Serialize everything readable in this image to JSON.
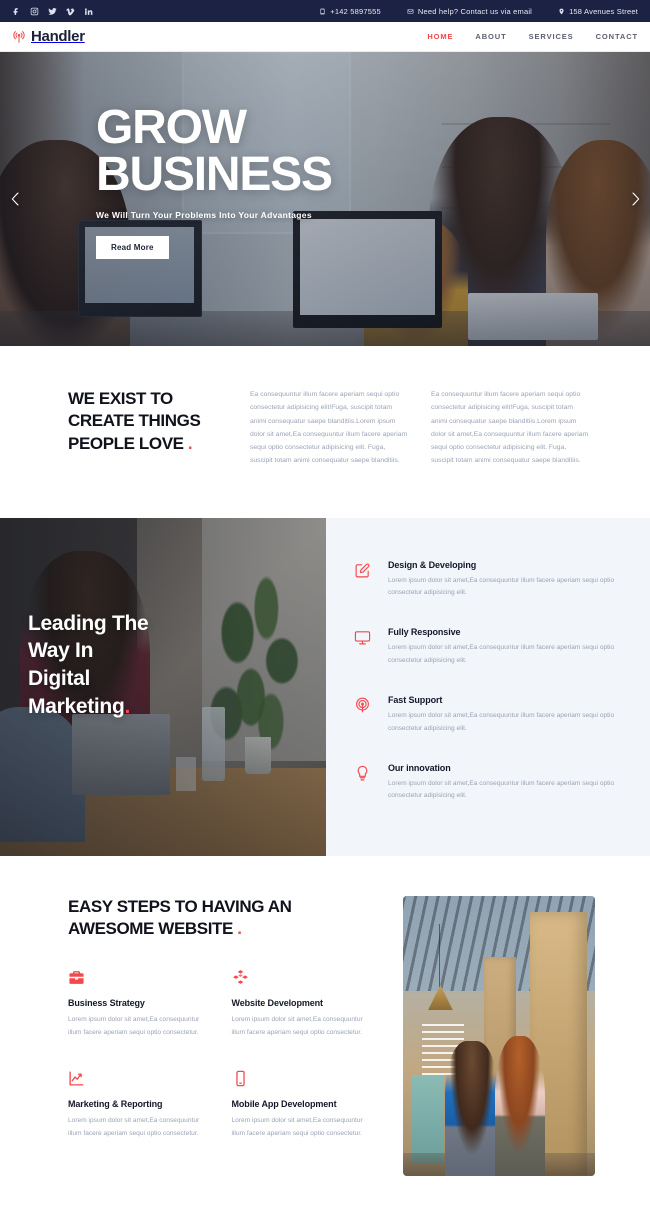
{
  "topbar": {
    "social": [
      {
        "name": "facebook-icon",
        "label": "Facebook"
      },
      {
        "name": "instagram-icon",
        "label": "Instagram"
      },
      {
        "name": "twitter-icon",
        "label": "Twitter"
      },
      {
        "name": "vimeo-icon",
        "label": "Vimeo"
      },
      {
        "name": "linkedin-icon",
        "label": "LinkedIn"
      }
    ],
    "phone": "+142 5897555",
    "email_text": "Need help? Contact us via email",
    "address": "158 Avenues Street"
  },
  "header": {
    "brand": "Handler",
    "logo_icon": "broadcast-icon",
    "nav": [
      {
        "label": "HOME",
        "active": true
      },
      {
        "label": "ABOUT",
        "active": false
      },
      {
        "label": "SERVICES",
        "active": false
      },
      {
        "label": "CONTACT",
        "active": false
      }
    ]
  },
  "hero": {
    "title_line1": "GROW",
    "title_line2": "BUSINESS",
    "subtitle": "We Will Turn Your Problems Into Your Advantages",
    "button": "Read More",
    "prev_arrow": "chevron-left-icon",
    "next_arrow": "chevron-right-icon"
  },
  "exist": {
    "heading_line1": "WE EXIST TO",
    "heading_line2": "CREATE THINGS",
    "heading_line3": "PEOPLE LOVE",
    "accent": ".",
    "paragraph1": "Ea consequuntur illum facere aperiam sequi optio consectetur adipisicing elit!Fuga, suscipit totam animi consequatur saepe blanditiis.Lorem ipsum dolor sit amet,Ea consequuntur illum facere aperiam sequi optio consectetur adipisicing elit. Fuga, suscipit totam animi consequatur saepe blanditiis.",
    "paragraph2": "Ea consequuntur illum facere aperiam sequi optio consectetur adipisicing elit!Fuga, suscipit totam animi consequatur saepe blanditiis.Lorem ipsum dolor sit amet,Ea consequuntur illum facere aperiam sequi optio consectetur adipisicing elit. Fuga, suscipit totam animi consequatur saepe blanditiis."
  },
  "leading": {
    "title_line1": "Leading The",
    "title_line2": "Way In",
    "title_line3": "Digital",
    "title_line4": "Marketing",
    "accent": ".",
    "features": [
      {
        "icon": "pencil-edit-icon",
        "title": "Design & Developing",
        "desc": "Lorem ipsum dolor sit amet,Ea consequuntur illum facere aperiam sequi optio consectetur adipisicing elit."
      },
      {
        "icon": "monitor-icon",
        "title": "Fully Responsive",
        "desc": "Lorem ipsum dolor sit amet,Ea consequuntur illum facere aperiam sequi optio consectetur adipisicing elit."
      },
      {
        "icon": "broadcast-icon",
        "title": "Fast Support",
        "desc": "Lorem ipsum dolor sit amet,Ea consequuntur illum facere aperiam sequi optio consectetur adipisicing elit."
      },
      {
        "icon": "lightbulb-icon",
        "title": "Our innovation",
        "desc": "Lorem ipsum dolor sit amet,Ea consequuntur illum facere aperiam sequi optio consectetur adipisicing elit."
      }
    ]
  },
  "steps": {
    "heading_line1": "EASY STEPS TO HAVING AN",
    "heading_line2": "AWESOME WEBSITE",
    "accent": ".",
    "items": [
      {
        "icon": "briefcase-icon",
        "title": "Business Strategy",
        "desc": "Lorem ipsum dolor sit amet,Ea consequuntur illum facere aperiam sequi optio consectetur."
      },
      {
        "icon": "cubes-icon",
        "title": "Website Development",
        "desc": "Lorem ipsum dolor sit amet,Ea consequuntur illum facere aperiam sequi optio consectetur."
      },
      {
        "icon": "chart-line-icon",
        "title": "Marketing & Reporting",
        "desc": "Lorem ipsum dolor sit amet,Ea consequuntur illum facere aperiam sequi optio consectetur."
      },
      {
        "icon": "mobile-phone-icon",
        "title": "Mobile App Development",
        "desc": "Lorem ipsum dolor sit amet,Ea consequuntur illum facere aperiam sequi optio consectetur."
      }
    ],
    "photo_alt": "office-walk-photo"
  },
  "colors": {
    "accent": "#f5484a",
    "dark_navy": "#1b2244",
    "heading": "#10121c",
    "muted_text": "#9aa3b5",
    "light_bg": "#f2f5fa"
  }
}
